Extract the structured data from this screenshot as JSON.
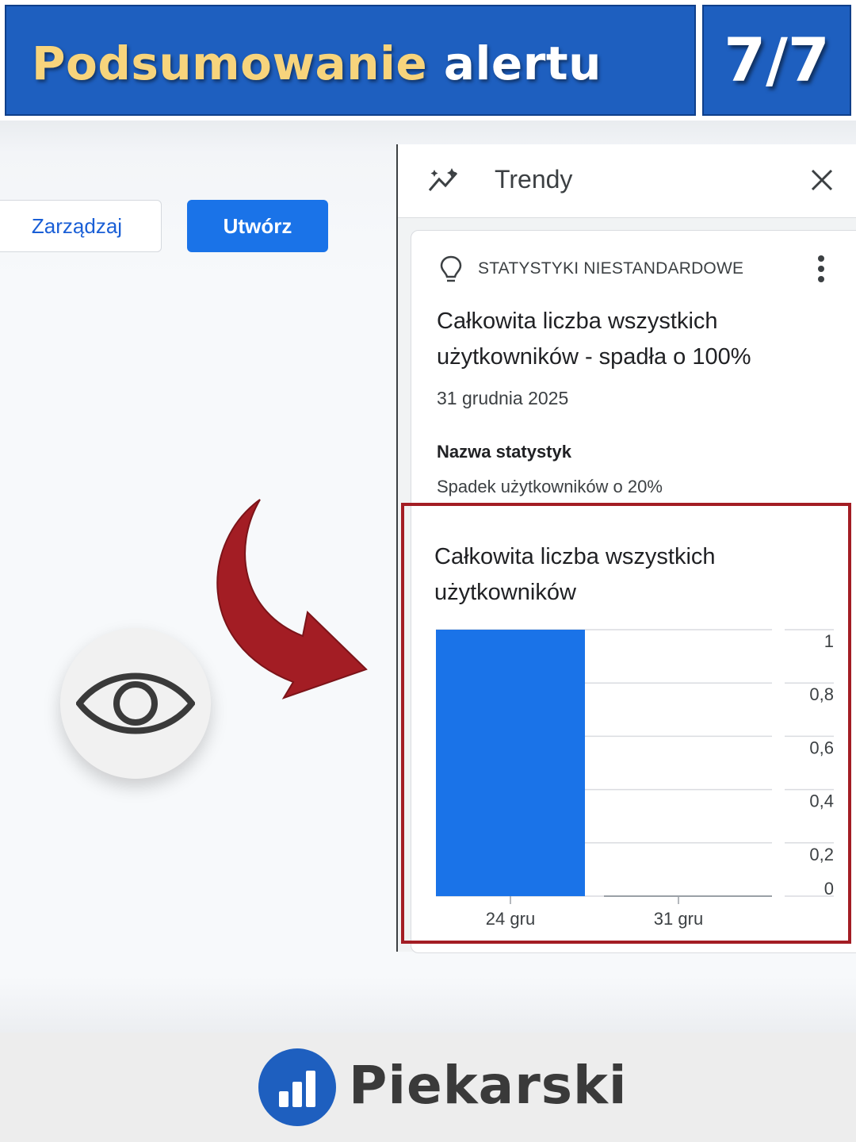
{
  "banner": {
    "title_accent": "Podsumowanie",
    "title_rest": "alertu",
    "step": "7/7"
  },
  "toolbar": {
    "manage_label": "Zarządzaj",
    "create_label": "Utwórz"
  },
  "panel": {
    "title": "Trendy",
    "card": {
      "kicker": "STATYSTYKI NIESTANDARDOWE",
      "title": "Całkowita liczba wszystkich użytkowników - spadła o 100%",
      "date": "31 grudnia 2025",
      "stat_label": "Nazwa statystyk",
      "stat_value": "Spadek użytkowników o 20%",
      "chart_title": "Całkowita liczba wszystkich użytkowników"
    }
  },
  "chart_data": {
    "type": "bar",
    "title": "Całkowita liczba wszystkich użytkowników",
    "categories": [
      "24 gru",
      "31 gru"
    ],
    "values": [
      1,
      0
    ],
    "y_ticks": [
      "1",
      "0,8",
      "0,6",
      "0,4",
      "0,2",
      "0"
    ],
    "ylim": [
      0,
      1
    ],
    "bar_color": "#1a73e8",
    "grid": true
  },
  "icons": {
    "trend": "trend-icon",
    "close": "close-icon",
    "bulb": "lightbulb-icon",
    "more": "more-vert-icon",
    "eye": "eye-icon",
    "arrow": "curved-arrow-icon"
  },
  "colors": {
    "banner_bg": "#1e5fbf",
    "banner_accent": "#f7d47c",
    "primary_button": "#1a73e8",
    "highlight": "#a31d24",
    "arrow": "#a31d24"
  },
  "footer": {
    "brand": "Piekarski"
  }
}
